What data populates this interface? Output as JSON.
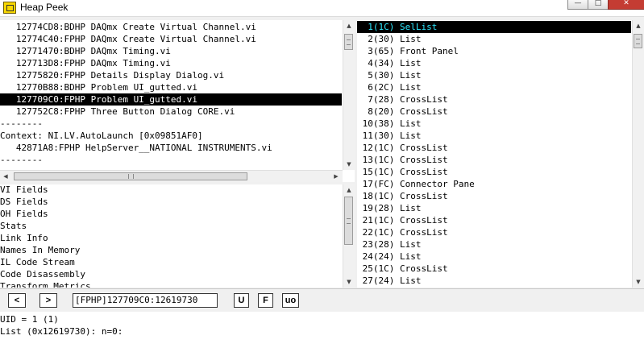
{
  "window": {
    "title": "Heap Peek",
    "buttons": {
      "minimize": "—",
      "maximize": "□",
      "close": "✕"
    }
  },
  "heap_list": {
    "lines": [
      "   12774CD8:BDHP DAQmx Create Virtual Channel.vi",
      "   12774C40:FPHP DAQmx Create Virtual Channel.vi",
      "   12771470:BDHP DAQmx Timing.vi",
      "   127713D8:FPHP DAQmx Timing.vi",
      "   12775820:FPHP Details Display Dialog.vi",
      "   12770B88:BDHP Problem UI_gutted.vi",
      "   127709C0:FPHP Problem UI_gutted.vi",
      "   127752C8:FPHP Three Button Dialog CORE.vi",
      "--------",
      "Context: NI.LV.AutoLaunch [0x09851AF0]",
      "   42871A8:FPHP HelpServer__NATIONAL INSTRUMENTS.vi",
      "--------"
    ],
    "selected_line": "   127709C0:FPHP Problem UI_gutted.vi"
  },
  "fields_list": {
    "lines": [
      "VI Fields",
      "DS Fields",
      "OH Fields",
      "Stats",
      "Link Info",
      "Names In Memory",
      "IL Code Stream",
      "Code Disassembly",
      "Transform Metrics"
    ]
  },
  "objects_list": {
    "lines": [
      "  1(1C) SelList",
      "  2(30) List",
      "  3(65) Front Panel",
      "  4(34) List",
      "  5(30) List",
      "  6(2C) List",
      "  7(28) CrossList",
      "  8(20) CrossList",
      " 10(38) List",
      " 11(30) List",
      " 12(1C) CrossList",
      " 13(1C) CrossList",
      " 15(1C) CrossList",
      " 17(FC) Connector Pane",
      " 18(1C) CrossList",
      " 19(28) List",
      " 21(1C) CrossList",
      " 22(1C) CrossList",
      " 23(28) List",
      " 24(24) List",
      " 25(1C) CrossList",
      " 27(24) List"
    ],
    "selected_line": "  1(1C) SelList"
  },
  "toolbar": {
    "back": "<",
    "forward": ">",
    "address": "[FPHP]127709C0:12619730",
    "u": "U",
    "f": "F",
    "uo": "uo"
  },
  "details": {
    "lines": [
      "UID = 1 (1)",
      "List (0x12619730): n=0:"
    ]
  },
  "colors": {
    "selection_bg": "#000000",
    "selection_text_left": "#ffffff",
    "selection_text_right": "#2de8ff",
    "close_button": "#c43c33"
  },
  "icons": {
    "app": "labview-icon",
    "scroll_up": "▲",
    "scroll_down": "▼",
    "scroll_left": "◀",
    "scroll_right": "▶"
  }
}
